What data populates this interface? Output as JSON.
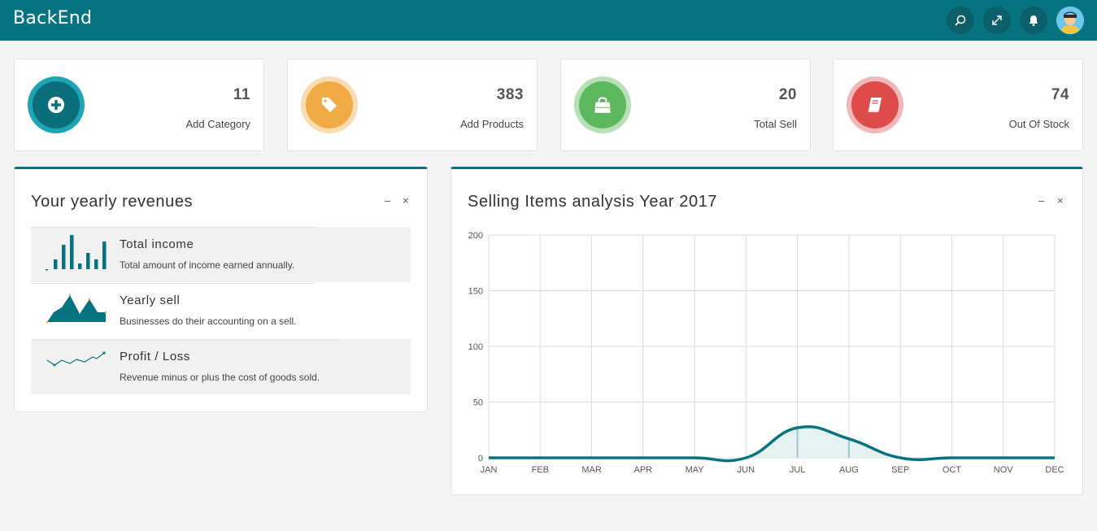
{
  "app": {
    "logo": "BackEnd"
  },
  "topbar": {
    "buttons": [
      {
        "icon": "search-icon"
      },
      {
        "icon": "expand-icon"
      },
      {
        "icon": "bell-icon"
      }
    ],
    "avatar": "user-avatar"
  },
  "stats": [
    {
      "value": "11",
      "label": "Add Category",
      "icon": "plus-circle-icon",
      "color": "#0a7f8c",
      "ring": "#1ea5b3"
    },
    {
      "value": "383",
      "label": "Add Products",
      "icon": "tag-icon",
      "color": "#f0ab45",
      "ring": "#f9dcb1"
    },
    {
      "value": "20",
      "label": "Total Sell",
      "icon": "shopping-bag-icon",
      "color": "#5cb85c",
      "ring": "#b8e0b8"
    },
    {
      "value": "74",
      "label": "Out Of Stock",
      "icon": "book-icon",
      "color": "#dd4b4b",
      "ring": "#f0b8b8"
    }
  ],
  "revenues": {
    "title": "Your yearly revenues",
    "minimize": "–",
    "close": "×",
    "items": [
      {
        "title": "Total income",
        "desc": "Total amount of income earned annually."
      },
      {
        "title": "Yearly sell",
        "desc": "Businesses do their accounting on a sell."
      },
      {
        "title": "Profit / Loss",
        "desc": "Revenue minus or plus the cost of goods sold."
      }
    ]
  },
  "analysis": {
    "title": "Selling Items analysis Year 2017",
    "minimize": "–",
    "close": "×"
  },
  "chart_data": {
    "type": "area",
    "categories": [
      "JAN",
      "FEB",
      "MAR",
      "APR",
      "MAY",
      "JUN",
      "JUL",
      "AUG",
      "SEP",
      "OCT",
      "NOV",
      "DEC"
    ],
    "series": [
      {
        "values": [
          0,
          0,
          0,
          0,
          0,
          0,
          27,
          17,
          0,
          0,
          0,
          0
        ]
      }
    ],
    "yticks": [
      0,
      50,
      100,
      150,
      200
    ],
    "ylim": [
      0,
      200
    ],
    "grid": true,
    "color": "#087380",
    "fill": "#e6f2f2"
  }
}
